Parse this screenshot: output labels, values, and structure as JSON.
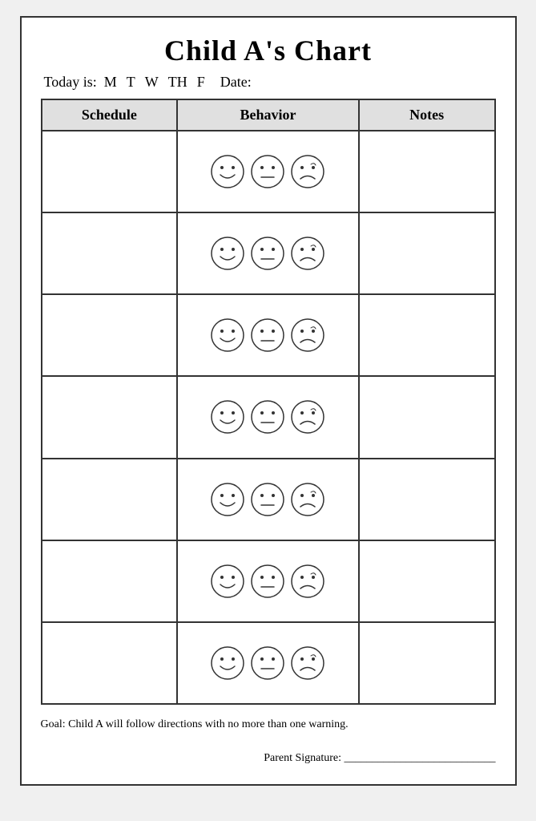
{
  "title": "Child A's Chart",
  "today_label": "Today is:",
  "days": [
    "M",
    "T",
    "W",
    "TH",
    "F"
  ],
  "date_label": "Date:",
  "headers": {
    "schedule": "Schedule",
    "behavior": "Behavior",
    "notes": "Notes"
  },
  "rows": [
    {
      "id": 1
    },
    {
      "id": 2
    },
    {
      "id": 3
    },
    {
      "id": 4
    },
    {
      "id": 5
    },
    {
      "id": 6
    },
    {
      "id": 7
    }
  ],
  "goal": "Goal: Child A will follow directions with no more than one warning.",
  "signature_label": "Parent Signature: ___________________________"
}
